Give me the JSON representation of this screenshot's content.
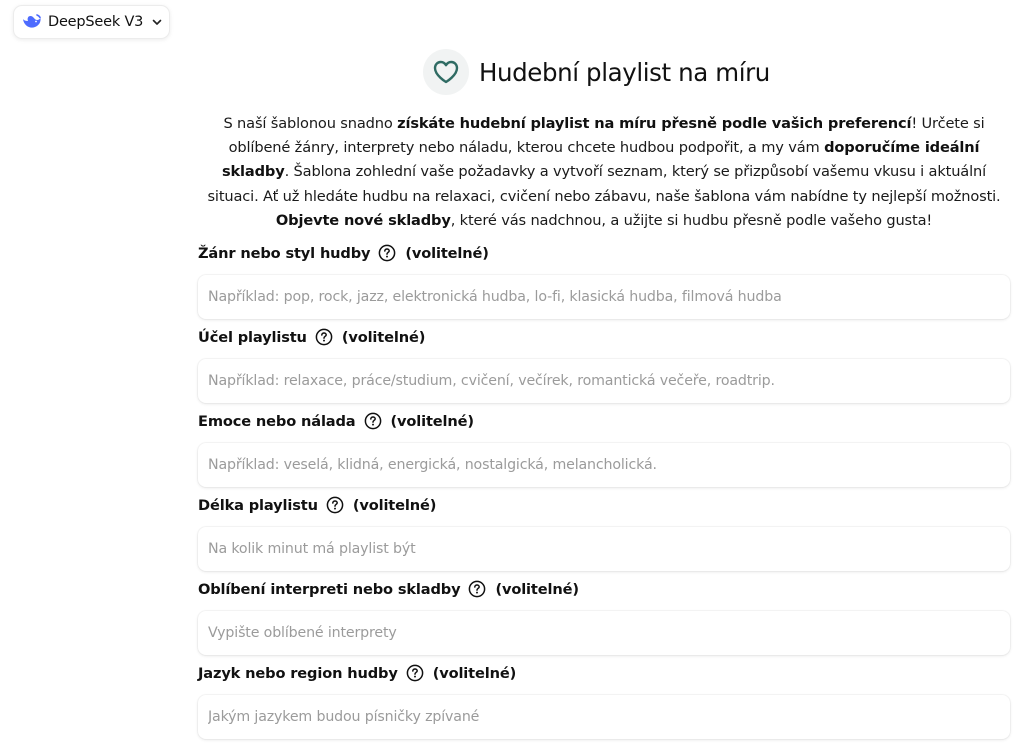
{
  "model_selector": {
    "label": "DeepSeek V3",
    "icon": "whale-logo-icon",
    "accent": "#4d6bfe"
  },
  "header": {
    "title": "Hudební playlist na míru",
    "icon": "heart-icon",
    "icon_color": "#2f6b63"
  },
  "intro": {
    "t1": "S naší šablonou snadno ",
    "b1": "získáte hudební playlist na míru přesně podle vašich preferencí",
    "t2": "! Určete si oblíbené žánry, interprety nebo náladu, kterou chcete hudbou podpořit, a my vám ",
    "b2": "doporučíme ideální skladby",
    "t3": ". Šablona zohlední vaše požadavky a vytvoří seznam, který se přizpůsobí vašemu vkusu i aktuální situaci. Ať už hledáte hudbu na relaxaci, cvičení nebo zábavu, naše šablona vám nabídne ty nejlepší možnosti. ",
    "b3": "Objevte nové skladby",
    "t4": ", které vás nadchnou, a užijte si hudbu přesně podle vašeho gusta!"
  },
  "optional_label": "(volitelné)",
  "fields": [
    {
      "label": "Žánr nebo styl hudby",
      "placeholder": "Například: pop, rock, jazz, elektronická hudba, lo-fi, klasická hudba, filmová hudba",
      "value": ""
    },
    {
      "label": "Účel playlistu",
      "placeholder": "Například: relaxace, práce/studium, cvičení, večírek, romantická večeře, roadtrip.",
      "value": ""
    },
    {
      "label": "Emoce nebo nálada",
      "placeholder": "Například: veselá, klidná, energická, nostalgická, melancholická.",
      "value": ""
    },
    {
      "label": "Délka playlistu",
      "placeholder": "Na kolik minut má playlist být",
      "value": ""
    },
    {
      "label": "Oblíbení interpreti nebo skladby",
      "placeholder": "Vypište oblíbené interprety",
      "value": ""
    },
    {
      "label": "Jazyk nebo region hudby",
      "placeholder": "Jakým jazykem budou písničky zpívané",
      "value": ""
    }
  ]
}
